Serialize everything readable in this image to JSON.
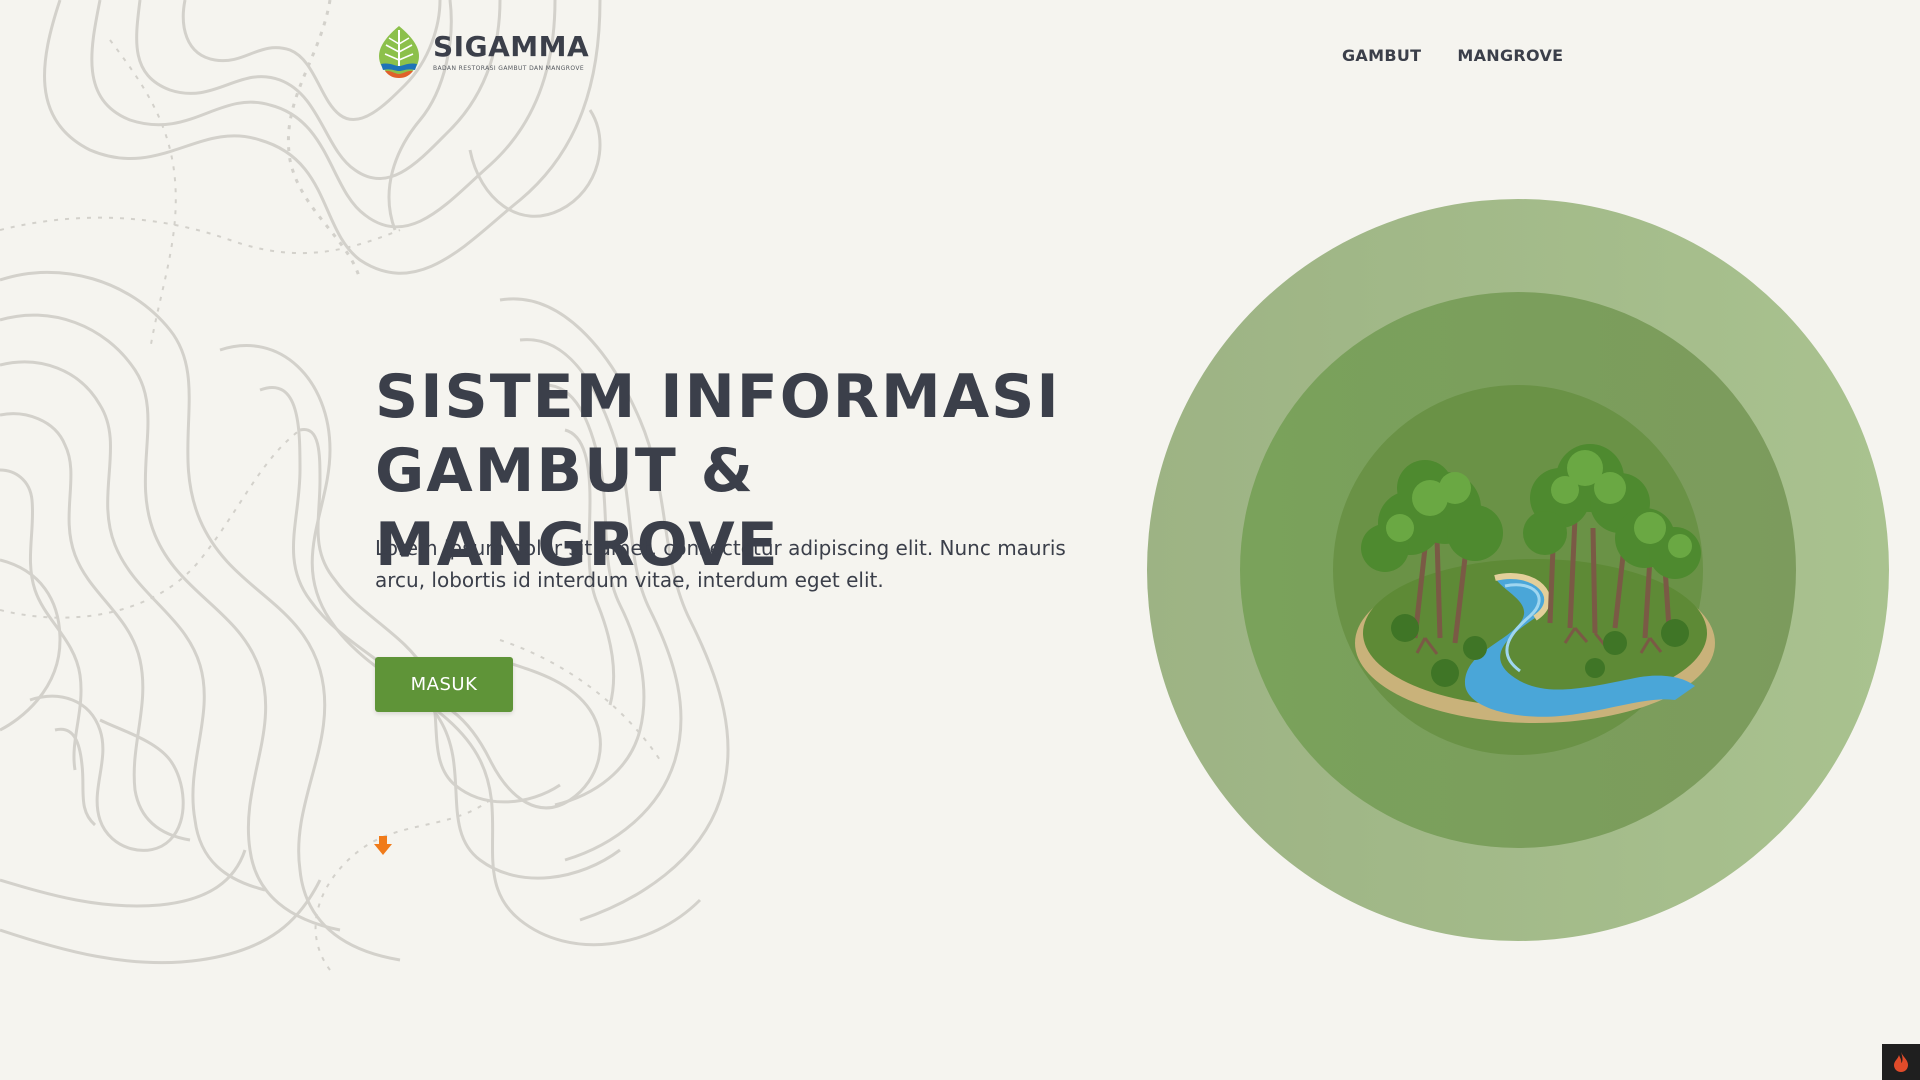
{
  "header": {
    "brand_name": "SIGAMMA",
    "brand_tagline": "BADAN RESTORASI GAMBUT DAN MANGROVE",
    "nav": [
      {
        "label": "GAMBUT"
      },
      {
        "label": "MANGROVE"
      }
    ]
  },
  "hero": {
    "title_line1": "SISTEM INFORMASI",
    "title_line2": "GAMBUT & MANGROVE",
    "description": "Lorem ipsum dolor sit amet, consectetur adipiscing elit. Nunc mauris arcu, lobortis id interdum vitae, interdum eget elit.",
    "cta_label": "MASUK"
  },
  "icons": {
    "logo": "leaf-logo-icon",
    "scroll": "arrow-down-icon",
    "corner": "flame-icon"
  },
  "colors": {
    "background": "#f5f4ef",
    "text": "#3b3f4a",
    "primary_green": "#5f9438",
    "ring_outer": "#a9c28f",
    "ring_mid": "#7aa25b",
    "ring_inner": "#6a9246",
    "accent_orange": "#f07b1a"
  }
}
